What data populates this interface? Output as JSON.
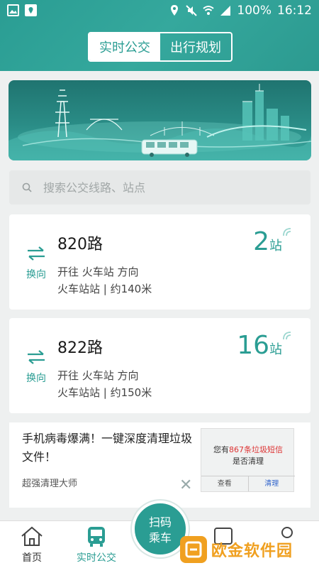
{
  "status_bar": {
    "battery": "100%",
    "time": "16:12"
  },
  "header": {
    "tabs": [
      {
        "label": "实时公交",
        "active": true
      },
      {
        "label": "出行规划",
        "active": false
      }
    ]
  },
  "search": {
    "placeholder": "搜索公交线路、站点"
  },
  "routes": [
    {
      "swap_label": "换向",
      "name": "820路",
      "direction": "开往 火车站 方向",
      "distance": "火车站站 | 约140米",
      "stops": "2",
      "stops_unit": "站"
    },
    {
      "swap_label": "换向",
      "name": "822路",
      "direction": "开往 火车站 方向",
      "distance": "火车站站 | 约150米",
      "stops": "16",
      "stops_unit": "站"
    }
  ],
  "ad": {
    "text": "手机病毒爆满！一键深度清理垃圾文件！",
    "source": "超强清理大师",
    "image_line1_prefix": "您有",
    "image_number": "867",
    "image_line1_suffix": "条垃圾短信",
    "image_line2": "是否清理",
    "image_btn_view": "查看",
    "image_btn_clean": "清理"
  },
  "bottom_nav": {
    "home": "首页",
    "realtime": "实时公交",
    "scan": "扫码",
    "scan2": "乘车"
  },
  "watermark": {
    "text": "欧金软件园"
  },
  "colors": {
    "accent": "#2a9d93",
    "watermark": "#f0a020"
  }
}
